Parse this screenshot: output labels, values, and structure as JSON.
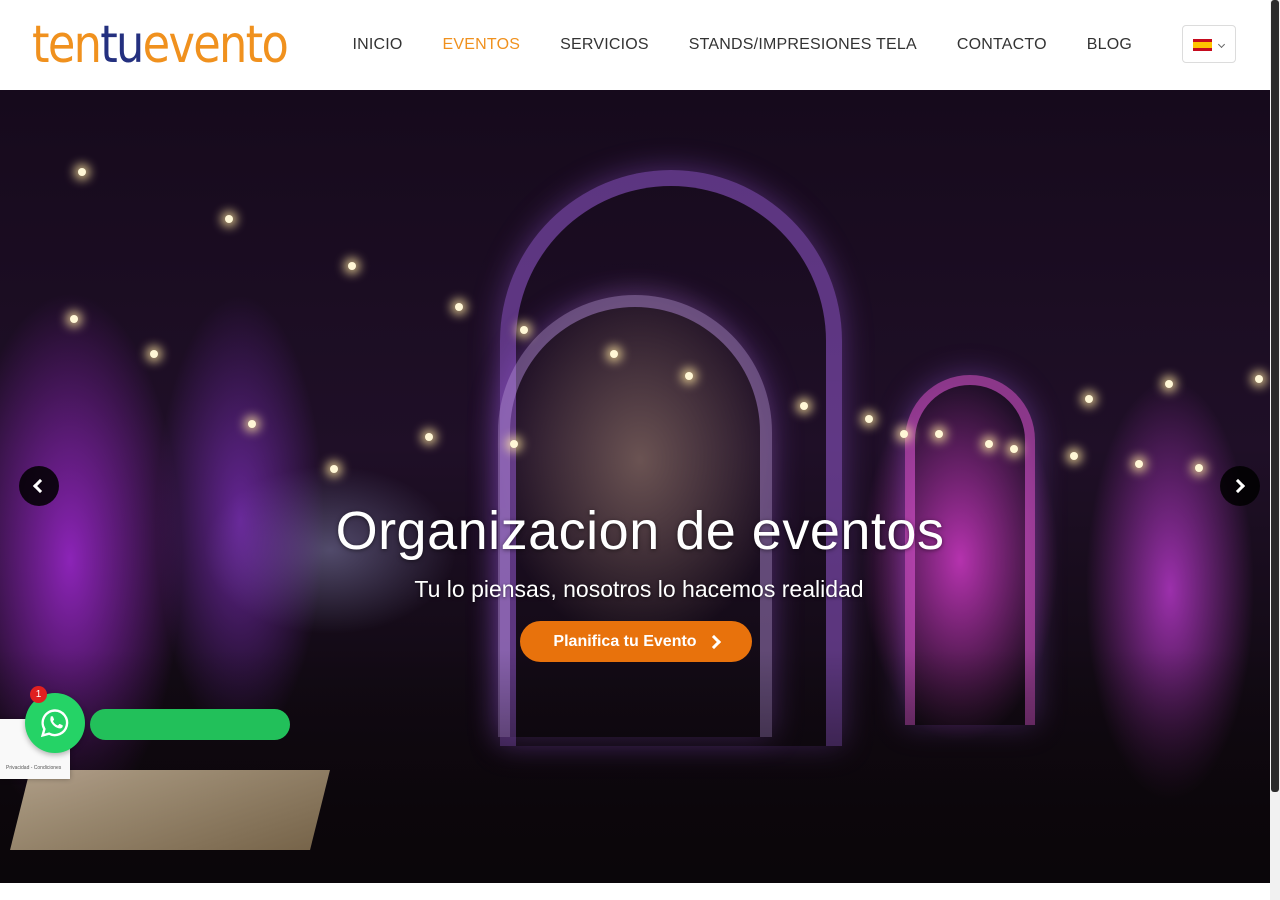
{
  "header": {
    "logo": {
      "part1": "ten",
      "part2": "tu",
      "part3": "evento"
    },
    "nav": [
      {
        "label": "INICIO",
        "active": false
      },
      {
        "label": "EVENTOS",
        "active": true
      },
      {
        "label": "SERVICIOS",
        "active": false
      },
      {
        "label": "STANDS/IMPRESIONES TELA",
        "active": false
      },
      {
        "label": "CONTACTO",
        "active": false
      },
      {
        "label": "BLOG",
        "active": false
      }
    ],
    "language": {
      "flag_icon": "spain-flag-icon",
      "dropdown_icon": "chevron-down-icon"
    }
  },
  "hero": {
    "title": "Organizacion de eventos",
    "subtitle": "Tu lo piensas, nosotros lo hacemos realidad",
    "cta_label": "Planifica tu Evento",
    "prev_icon": "chevron-left-icon",
    "next_icon": "chevron-right-icon"
  },
  "widgets": {
    "whatsapp_badge": "1",
    "recaptcha_text": "Privacidad - Condiciones"
  },
  "colors": {
    "accent": "#f0911e",
    "logo_blue": "#24307f",
    "cta": "#e8720c",
    "whatsapp": "#25d366"
  }
}
